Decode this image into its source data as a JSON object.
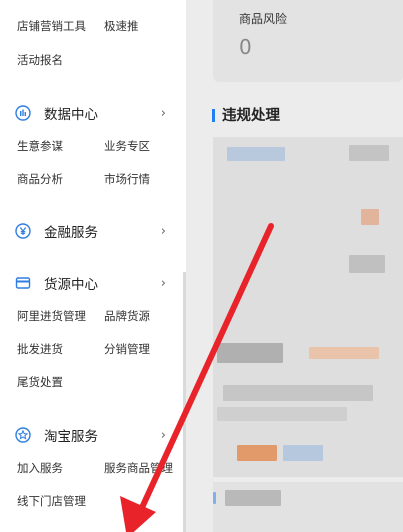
{
  "sidebar": {
    "top_links": [
      "店铺营销工具",
      "极速推",
      "活动报名"
    ],
    "sections": [
      {
        "label": "数据中心",
        "icon": "chart-icon",
        "links": [
          "生意参谋",
          "业务专区",
          "商品分析",
          "市场行情"
        ]
      },
      {
        "label": "金融服务",
        "icon": "yen-icon",
        "links": []
      },
      {
        "label": "货源中心",
        "icon": "card-icon",
        "links": [
          "阿里进货管理",
          "品牌货源",
          "批发进货",
          "分销管理",
          "尾货处置"
        ]
      },
      {
        "label": "淘宝服务",
        "icon": "star-icon",
        "links": [
          "加入服务",
          "服务商品管理",
          "线下门店管理"
        ]
      }
    ],
    "chevron": "›"
  },
  "main": {
    "risk_label": "商品风险",
    "risk_value": "0",
    "violation_title": "违规处理"
  },
  "colors": {
    "accent": "#1e7ef2",
    "icon_blue": "#2f7de1",
    "arrow_red": "#e8232a"
  }
}
